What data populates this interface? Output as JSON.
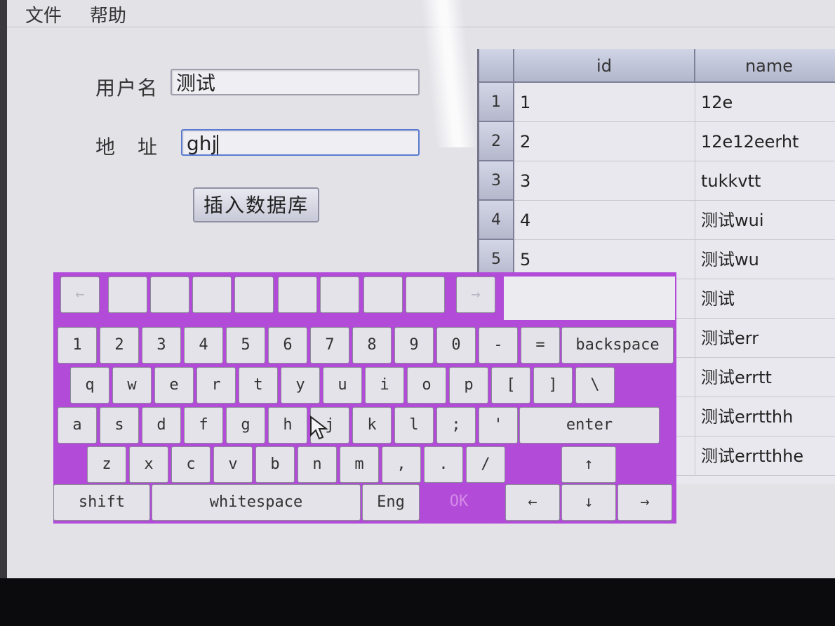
{
  "menu": [
    "文件",
    "帮助"
  ],
  "form": {
    "username_label": "用户名",
    "username_value": "测试",
    "address_label": "地　址",
    "address_value": "ghj",
    "insert_button": "插入数据库"
  },
  "table": {
    "headers": [
      "id",
      "name"
    ],
    "rows": [
      {
        "n": "1",
        "id": "1",
        "name": "12e"
      },
      {
        "n": "2",
        "id": "2",
        "name": "12e12eerht"
      },
      {
        "n": "3",
        "id": "3",
        "name": "tukkvtt"
      },
      {
        "n": "4",
        "id": "4",
        "name": "测试wui"
      },
      {
        "n": "5",
        "id": "5",
        "name": "测试wu"
      },
      {
        "n": "",
        "id": "",
        "name": "测试"
      },
      {
        "n": "",
        "id": "",
        "name": "测试err"
      },
      {
        "n": "",
        "id": "",
        "name": "测试errtt"
      },
      {
        "n": "",
        "id": "",
        "name": "测试errtthh"
      },
      {
        "n": "",
        "id": "",
        "name": "测试errtthhe"
      }
    ]
  },
  "keyboard": {
    "candidate_prev": "←",
    "candidate_next": "→",
    "row_numbers": [
      "1",
      "2",
      "3",
      "4",
      "5",
      "6",
      "7",
      "8",
      "9",
      "0",
      "-",
      "="
    ],
    "backspace": "backspace",
    "row_q": [
      "q",
      "w",
      "e",
      "r",
      "t",
      "y",
      "u",
      "i",
      "o",
      "p",
      "[",
      "]",
      "\\"
    ],
    "row_a": [
      "a",
      "s",
      "d",
      "f",
      "g",
      "h",
      "j",
      "k",
      "l",
      ";",
      "'"
    ],
    "enter": "enter",
    "row_z": [
      "z",
      "x",
      "c",
      "v",
      "b",
      "n",
      "m",
      ",",
      ".",
      "/"
    ],
    "up": "↑",
    "shift": "shift",
    "whitespace": "whitespace",
    "eng": "Eng",
    "ok": "OK",
    "left": "←",
    "down": "↓",
    "right": "→"
  },
  "colors": {
    "keyboard_bg": "#b14bd8",
    "screen_bg": "#e3e2e7",
    "focus_border": "#5a7bd1"
  }
}
